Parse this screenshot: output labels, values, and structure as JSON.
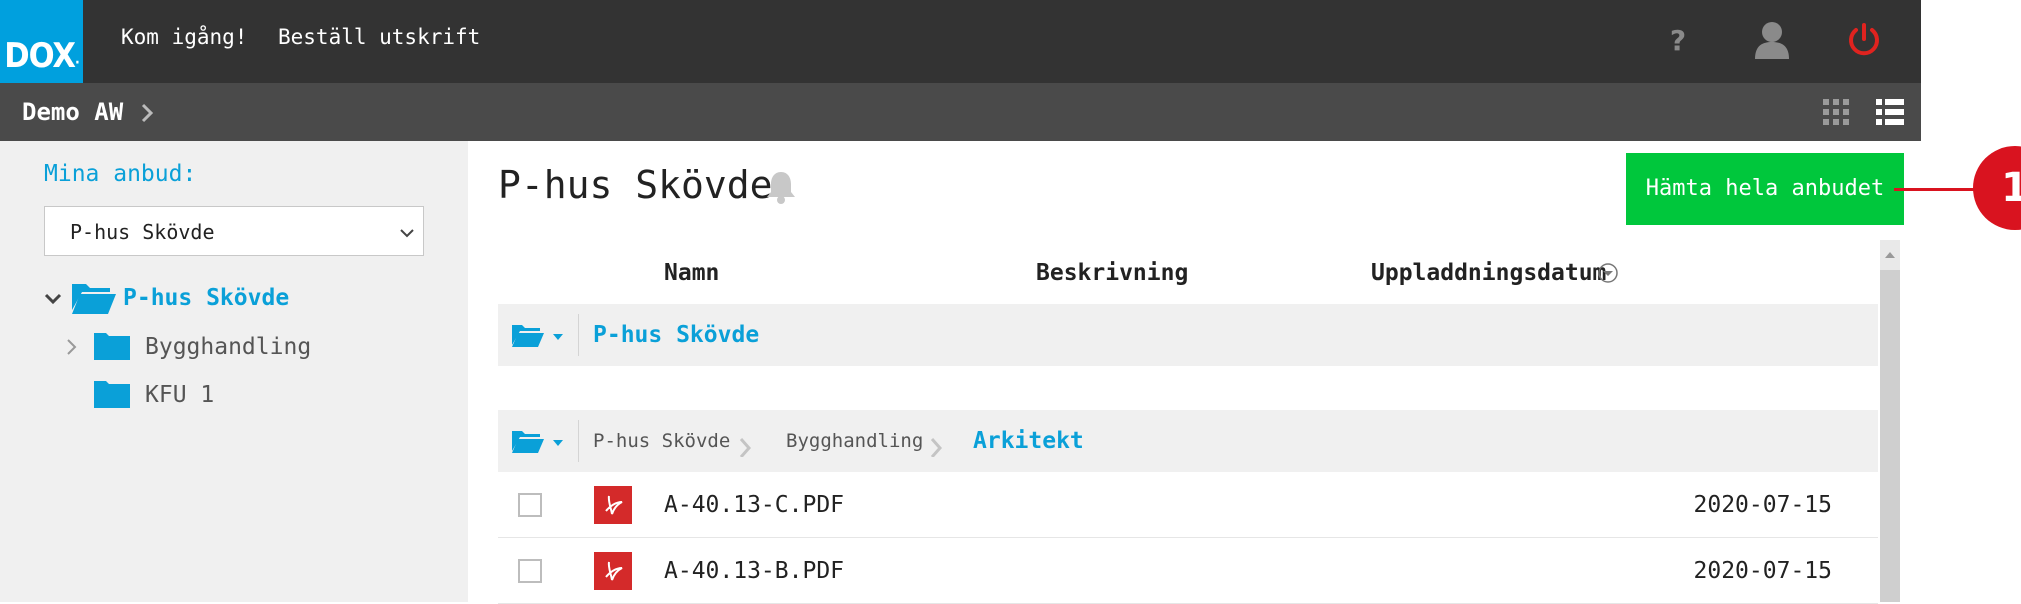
{
  "brand": {
    "logo_text": "DOX"
  },
  "topnav": {
    "get_started": "Kom igång!",
    "order_print": "Beställ utskrift"
  },
  "subbar": {
    "breadcrumb": "Demo AW"
  },
  "sidebar": {
    "label": "Mina anbud:",
    "select_value": "P-hus Skövde",
    "tree": [
      {
        "label": "P-hus Skövde"
      },
      {
        "label": "Bygghandling"
      },
      {
        "label": "KFU 1"
      }
    ]
  },
  "main": {
    "title": "P-hus Skövde",
    "download_button": "Hämta hela anbudet",
    "callout_number": "1",
    "columns": {
      "name": "Namn",
      "description": "Beskrivning",
      "upload_date": "Uppladdningsdatum"
    },
    "group1": {
      "folder": "P-hus Skövde"
    },
    "group2": {
      "path": [
        "P-hus Skövde",
        "Bygghandling"
      ],
      "current": "Arkitekt"
    },
    "files": [
      {
        "name": "A-40.13-C.PDF",
        "date": "2020-07-15"
      },
      {
        "name": "A-40.13-B.PDF",
        "date": "2020-07-15"
      }
    ]
  },
  "colors": {
    "accent": "#00a0de",
    "success": "#00c73c",
    "danger": "#d9131f",
    "topbar": "#333333"
  },
  "icons": [
    "help-icon",
    "user-icon",
    "power-icon",
    "chevron-right-icon",
    "grid-view-icon",
    "list-view-icon",
    "chevron-down-icon",
    "folder-open-icon",
    "folder-icon",
    "bell-icon",
    "sort-dropdown-icon",
    "pdf-icon"
  ]
}
